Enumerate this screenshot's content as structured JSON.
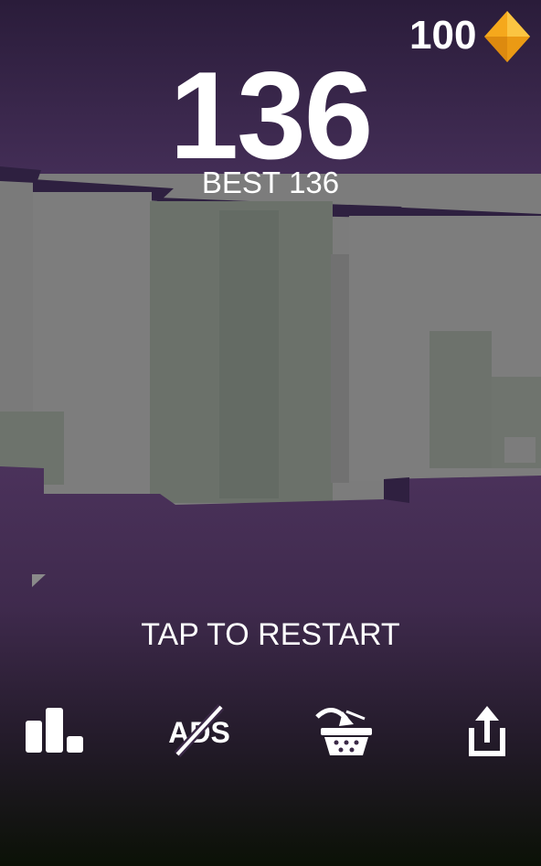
{
  "hud": {
    "gems": "100",
    "score": "136",
    "best_label": "BEST",
    "best_value": "136",
    "restart_label": "TAP TO RESTART"
  },
  "buttons": {
    "leaderboard": "leaderboard-icon",
    "no_ads": "ADS",
    "shop": "basket-icon",
    "share": "share-icon"
  },
  "colors": {
    "sky_top": "#2c1e3d",
    "sky_mid": "#48305f",
    "wall_gray": "#7b7b7b",
    "floor_purple": "#4a315a",
    "floor_bottom": "#0c1207",
    "gem": "#f5a81c"
  }
}
